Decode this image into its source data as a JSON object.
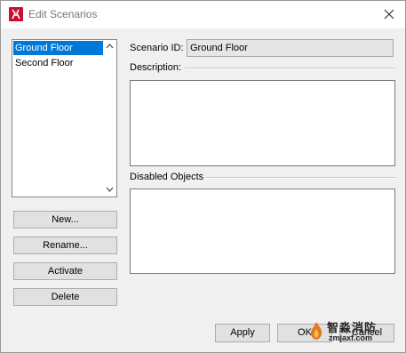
{
  "window": {
    "title": "Edit Scenarios",
    "accent_color": "#0078d7",
    "icon_color": "#c8102e"
  },
  "scenario_list": {
    "items": [
      {
        "label": "Ground Floor",
        "selected": true
      },
      {
        "label": "Second Floor",
        "selected": false
      }
    ]
  },
  "side_buttons": {
    "new": "New...",
    "rename": "Rename...",
    "activate": "Activate",
    "delete": "Delete"
  },
  "form": {
    "scenario_id_label": "Scenario ID:",
    "scenario_id_value": "Ground Floor",
    "description_label": "Description:",
    "disabled_objects_label": "Disabled Objects"
  },
  "bottom_buttons": {
    "apply": "Apply",
    "ok": "OK",
    "cancel": "Cancel"
  },
  "watermark": {
    "title": "智淼消防",
    "url": "zmjaxf.com"
  },
  "icons": {
    "app": "app-logo-icon",
    "close": "close-icon",
    "scroll_up": "chevron-up-icon",
    "scroll_down": "chevron-down-icon"
  }
}
